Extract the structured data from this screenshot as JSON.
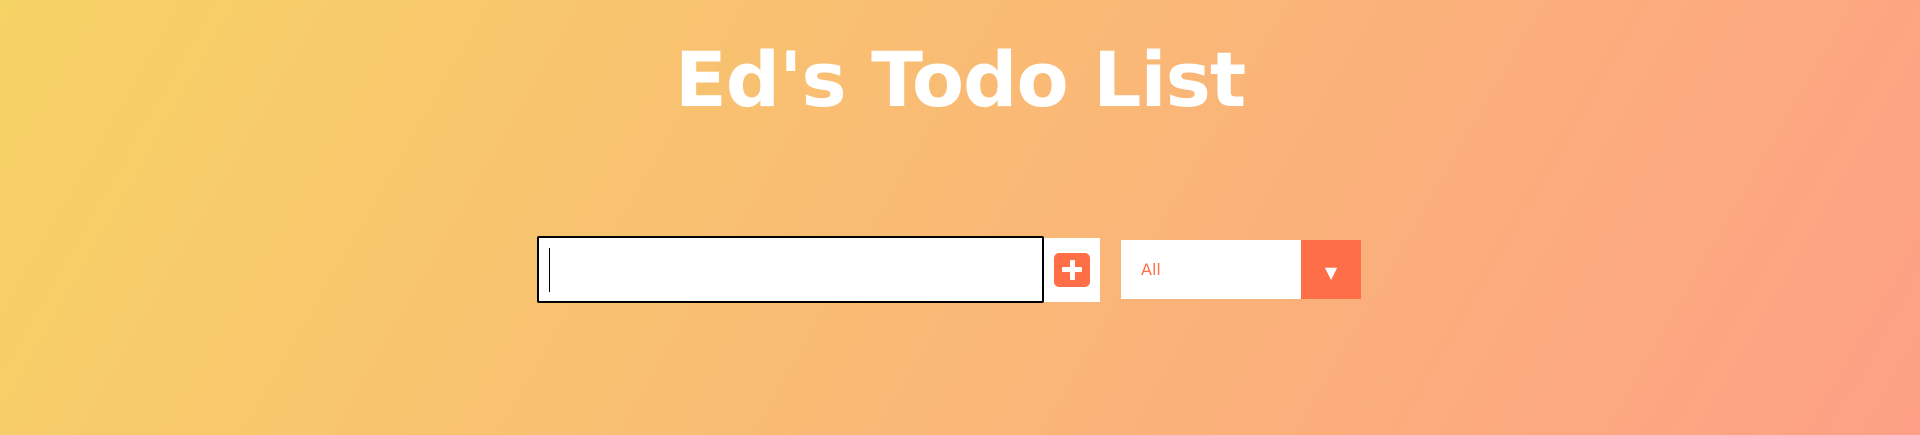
{
  "header": {
    "title": "Ed's Todo List"
  },
  "todo_form": {
    "input_value": "",
    "add_icon": "plus-square-icon"
  },
  "filter": {
    "selected": "All",
    "arrow_icon": "triangle-down-icon",
    "arrow_glyph": "▼"
  },
  "colors": {
    "gradient_start": "#f6d365",
    "gradient_end": "#fda085",
    "accent": "#ff6f47",
    "title_text": "#ffffff"
  }
}
